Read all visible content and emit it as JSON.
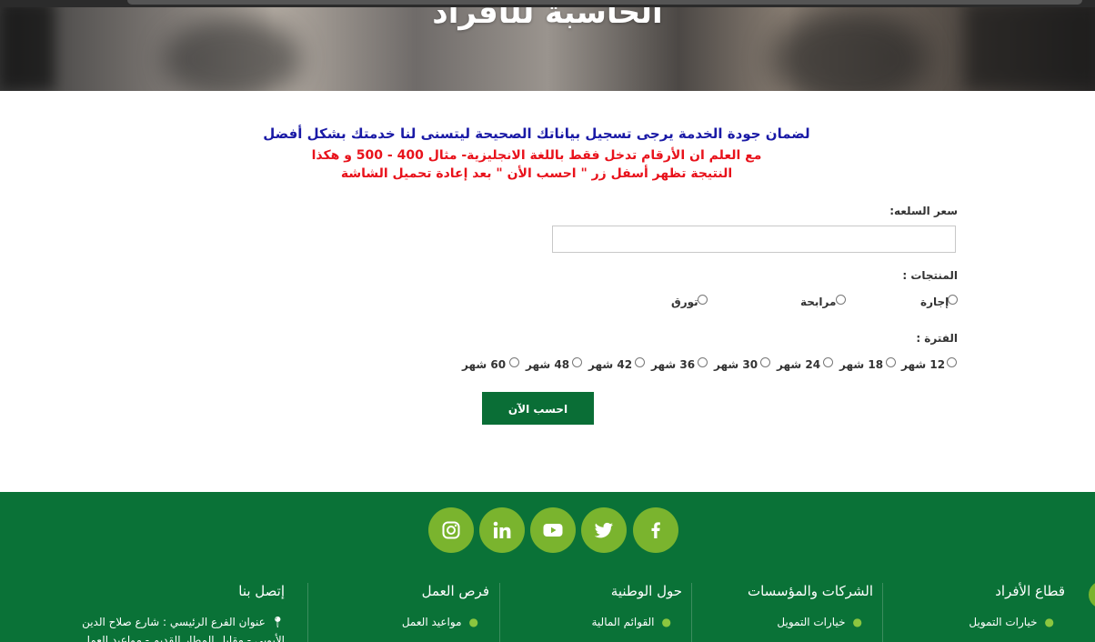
{
  "hero": {
    "title": "الحاسبة للأفراد"
  },
  "notice": {
    "line1": "لضمان جودة الخدمة يرجى تسجيل بياناتك الصحيحة ليتسنى لنا خدمتك بشكل أفضل",
    "line2": "مع العلم ان الأرقام تدخل فقط باللغة الانجليزية- مثال 400 - 500 و هكذا",
    "line3": "النتيجة تظهر أسفل زر \" احسب الأن \" بعد إعادة تحميل الشاشة"
  },
  "form": {
    "price_label": "سعر السلعه:",
    "price_value": "",
    "products_label": "المنتجات :",
    "products": [
      {
        "label": "إجارة",
        "selected": false
      },
      {
        "label": "مرابحة",
        "selected": false
      },
      {
        "label": "تورق",
        "selected": false
      }
    ],
    "period_label": "الفترة :",
    "periods": [
      {
        "label": "12 شهر",
        "selected": false
      },
      {
        "label": "18 شهر",
        "selected": false
      },
      {
        "label": "24 شهر",
        "selected": false
      },
      {
        "label": "30 شهر",
        "selected": false
      },
      {
        "label": "36 شهر",
        "selected": false
      },
      {
        "label": "42 شهر",
        "selected": false
      },
      {
        "label": "48 شهر",
        "selected": false
      },
      {
        "label": "60 شهر",
        "selected": false
      }
    ],
    "submit_label": "احسب الآن"
  },
  "footer": {
    "social": [
      "facebook-icon",
      "twitter-icon",
      "youtube-icon",
      "linkedin-icon",
      "instagram-icon"
    ],
    "columns": [
      {
        "title": "قطاع الأفراد",
        "items": [
          "خيارات التمويل"
        ]
      },
      {
        "title": "الشركات والمؤسسات",
        "items": [
          "خيارات التمويل"
        ]
      },
      {
        "title": "حول الوطنية",
        "items": [
          "القوائم المالية"
        ]
      },
      {
        "title": "فرص العمل",
        "items": [
          "مواعيد العمل"
        ]
      },
      {
        "title": "إتصل بنا",
        "items": [
          "عنوان الفرع الرئيسي : شارع صلاح الدين",
          "الأيوبي - مقابل المطار القديم - مواعيد العمل"
        ]
      }
    ]
  },
  "colors": {
    "accent_green": "#0a6e36",
    "social_green": "#7ab42e",
    "notice_blue": "#1a1aa6",
    "notice_red": "#e8121b"
  }
}
